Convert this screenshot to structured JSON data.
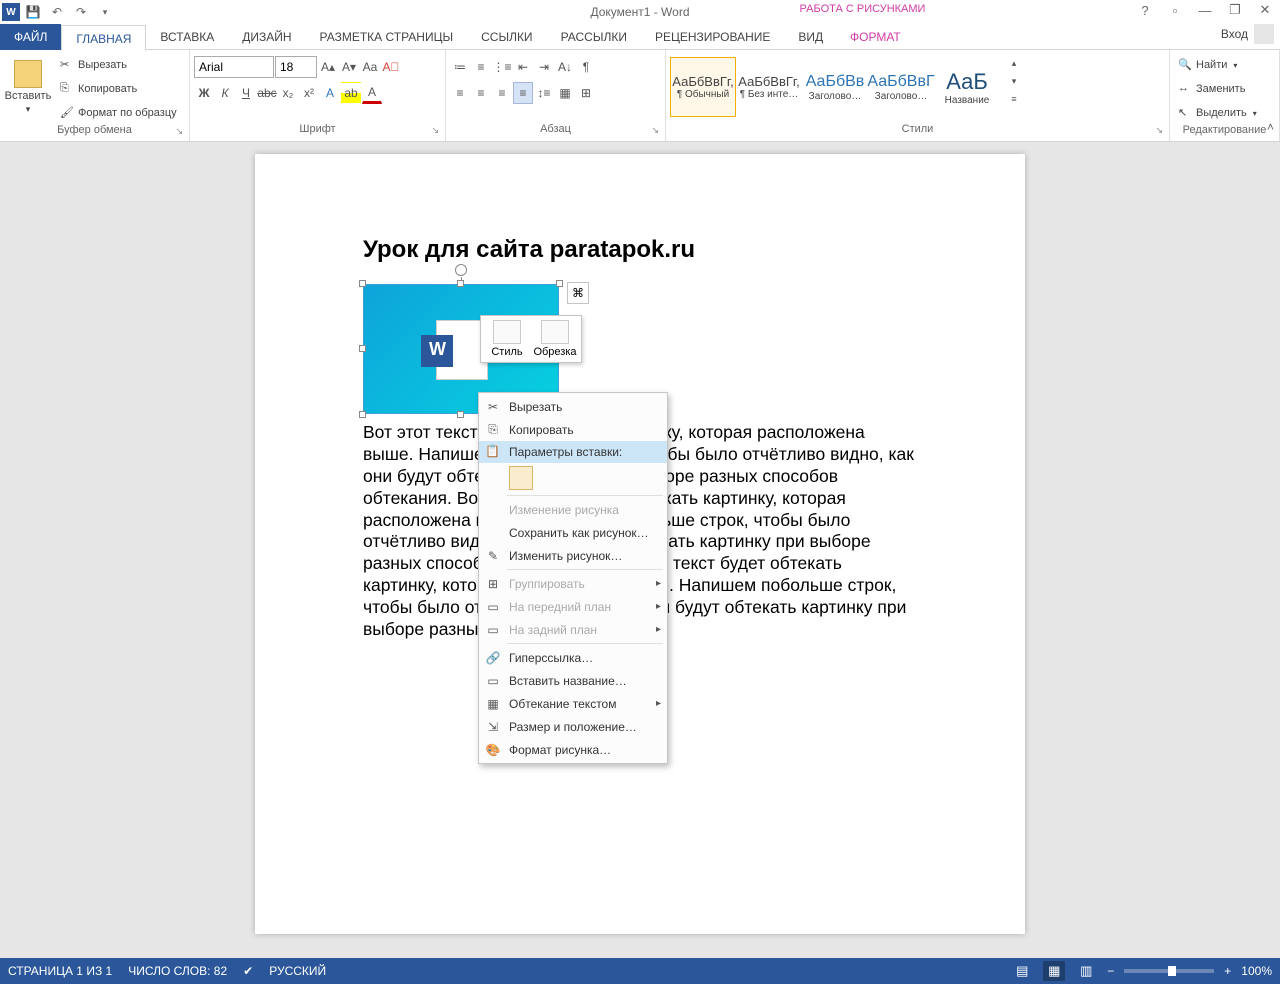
{
  "title": "Документ1 - Word",
  "context_tab": "РАБОТА С РИСУНКАМИ",
  "tabs": [
    "ФАЙЛ",
    "ГЛАВНАЯ",
    "ВСТАВКА",
    "ДИЗАЙН",
    "РАЗМЕТКА СТРАНИЦЫ",
    "ССЫЛКИ",
    "РАССЫЛКИ",
    "РЕЦЕНЗИРОВАНИЕ",
    "ВИД"
  ],
  "ctx_tab_label": "ФОРМАТ",
  "login": "Вход",
  "clipboard": {
    "paste": "Вставить",
    "cut": "Вырезать",
    "copy": "Копировать",
    "painter": "Формат по образцу",
    "group": "Буфер обмена"
  },
  "font": {
    "name": "Arial",
    "size": "18",
    "group": "Шрифт"
  },
  "para": {
    "group": "Абзац"
  },
  "styles": {
    "group": "Стили",
    "items": [
      {
        "prev": "АаБбВвГг,",
        "name": "¶ Обычный",
        "sel": true,
        "cls": ""
      },
      {
        "prev": "АаБбВвГг,",
        "name": "¶ Без инте…",
        "sel": false,
        "cls": ""
      },
      {
        "prev": "АаБбВв",
        "name": "Заголово…",
        "sel": false,
        "cls": "med"
      },
      {
        "prev": "АаБбВвГ",
        "name": "Заголово…",
        "sel": false,
        "cls": "med"
      },
      {
        "prev": "АаБ",
        "name": "Название",
        "sel": false,
        "cls": "big"
      }
    ]
  },
  "editing": {
    "find": "Найти",
    "replace": "Заменить",
    "select": "Выделить",
    "group": "Редактирование"
  },
  "doc": {
    "heading": "Урок для сайта paratapok.ru",
    "body": "Вот этот текст будет обтекать картинку, которая расположена выше. Напишем побольше строк, чтобы было отчётливо видно, как они будут обтекать картинку при выборе разных способов обтекания. Вот этот текст будет обтекать картинку, которая расположена выше. Напишем побольше строк, чтобы было отчётливо видно, как они будут обтекать картинку при выборе разных способов обтекания. Вот этот текст будет обтекать картинку, которая расположена выше. Напишем побольше строк, чтобы было отчётливо видно, как они будут обтекать картинку при выборе разных способов обтекания."
  },
  "mini": {
    "style": "Стиль",
    "crop": "Обрезка"
  },
  "ctxmenu": {
    "cut": "Вырезать",
    "copy": "Копировать",
    "paste_label": "Параметры вставки:",
    "change": "Изменение рисунка",
    "saveas": "Сохранить как рисунок…",
    "edit": "Изменить рисунок…",
    "group": "Группировать",
    "front": "На передний план",
    "back": "На задний план",
    "link": "Гиперссылка…",
    "caption": "Вставить название…",
    "wrap": "Обтекание текстом",
    "sizepos": "Размер и положение…",
    "format": "Формат рисунка…"
  },
  "status": {
    "page": "СТРАНИЦА 1 ИЗ 1",
    "words": "ЧИСЛО СЛОВ: 82",
    "lang": "РУССКИЙ",
    "zoom": "100%"
  }
}
